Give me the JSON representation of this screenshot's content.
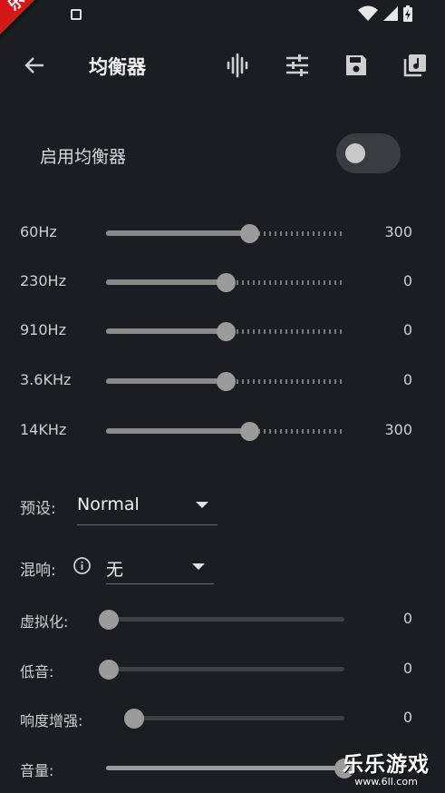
{
  "ribbon": {
    "text": "乐乐亲测"
  },
  "app_bar": {
    "title": "均衡器"
  },
  "enable": {
    "label": "启用均衡器",
    "on": false
  },
  "bands": [
    {
      "label": "60Hz",
      "value": "300",
      "position": 0.6
    },
    {
      "label": "230Hz",
      "value": "0",
      "position": 0.5
    },
    {
      "label": "910Hz",
      "value": "0",
      "position": 0.5
    },
    {
      "label": "3.6KHz",
      "value": "0",
      "position": 0.5
    },
    {
      "label": "14KHz",
      "value": "300",
      "position": 0.6
    }
  ],
  "preset": {
    "label": "预设:",
    "value": "Normal"
  },
  "reverb": {
    "label": "混响:",
    "value": "无"
  },
  "effects": [
    {
      "label": "虚拟化:",
      "value": "0",
      "position": 0
    },
    {
      "label": "低音:",
      "value": "0",
      "position": 0
    },
    {
      "label": "响度增强:",
      "value": "0",
      "position": 0
    },
    {
      "label": "音量:",
      "value": "",
      "position": 1.0
    }
  ],
  "watermark": {
    "text": "乐乐游戏",
    "url": "www.6ll.com"
  },
  "colors": {
    "background": "#1c1d20",
    "ribbon": "#d41717",
    "accent": "#9b9b9b"
  }
}
